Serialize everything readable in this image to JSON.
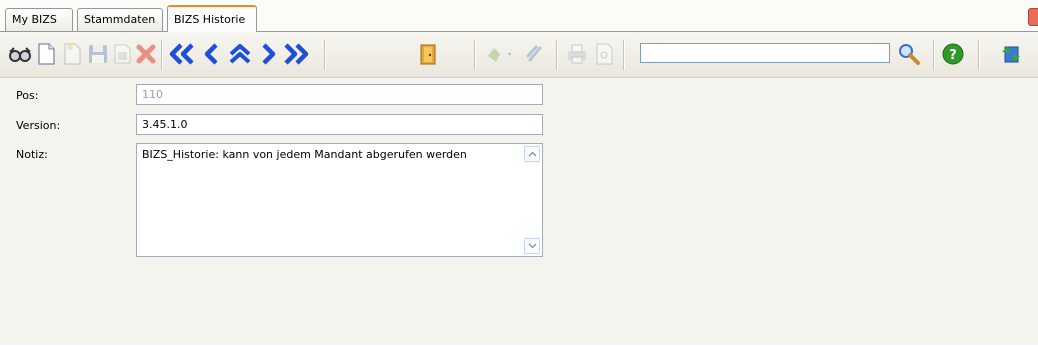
{
  "tabs": [
    {
      "label": "My BIZS"
    },
    {
      "label": "Stammdaten"
    },
    {
      "label": "BIZS Historie"
    }
  ],
  "toolbar": {
    "search_value": "",
    "icons": [
      "glasses-icon",
      "new-document-icon",
      "copy-document-icon",
      "save-icon",
      "print-preview-icon",
      "delete-icon",
      "first-record-icon",
      "previous-record-icon",
      "up-record-icon",
      "next-record-icon",
      "last-record-icon",
      "exit-door-icon",
      "attach-icon",
      "paperclip-icon",
      "print-icon",
      "page-preview-icon",
      "search-icon",
      "help-icon",
      "refresh-icon"
    ]
  },
  "form": {
    "pos_label": "Pos:",
    "pos_value": "110",
    "version_label": "Version:",
    "version_value": "3.45.1.0",
    "notiz_label": "Notiz:",
    "notiz_value": "BIZS_Historie: kann von jedem Mandant abgerufen werden"
  },
  "colors": {
    "nav_blue": "#1f4fd8",
    "active_tab_accent": "#e68b2c",
    "delete_red": "#e46a5a",
    "help_green": "#2f9a2a"
  }
}
